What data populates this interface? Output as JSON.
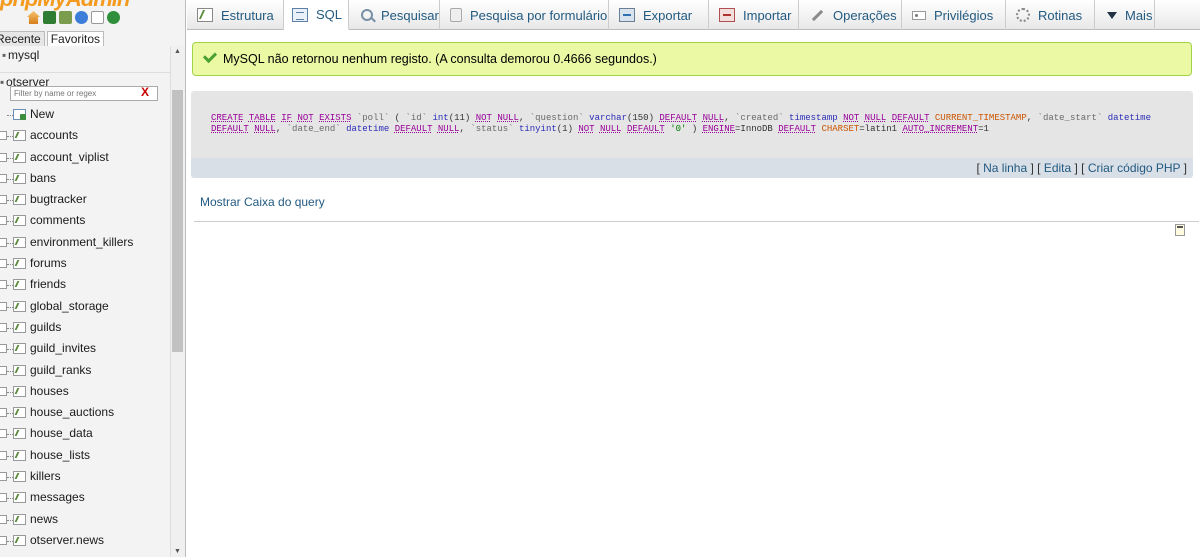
{
  "app": {
    "logo_text": "phpMyAdmin"
  },
  "nav": {
    "tabs": [
      "Recente",
      "Favoritos"
    ],
    "root_db": "mysql",
    "server": "otserver",
    "filter_placeholder": "Filter by name or regex",
    "filter_clear": "X",
    "new_label": "New",
    "tables": [
      "accounts",
      "account_viplist",
      "bans",
      "bugtracker",
      "comments",
      "environment_killers",
      "forums",
      "friends",
      "global_storage",
      "guilds",
      "guild_invites",
      "guild_ranks",
      "houses",
      "house_auctions",
      "house_data",
      "house_lists",
      "killers",
      "messages",
      "news",
      "otserver.news"
    ]
  },
  "topmenu": {
    "tabs": [
      {
        "label": "Estrutura",
        "icon": "structure-icon"
      },
      {
        "label": "SQL",
        "icon": "sql-icon",
        "active": true
      },
      {
        "label": "Pesquisar",
        "icon": "search-icon"
      },
      {
        "label": "Pesquisa por formulário",
        "icon": "form-icon"
      },
      {
        "label": "Exportar",
        "icon": "export-icon"
      },
      {
        "label": "Importar",
        "icon": "import-icon"
      },
      {
        "label": "Operações",
        "icon": "wrench-icon"
      },
      {
        "label": "Privilégios",
        "icon": "privileges-icon"
      },
      {
        "label": "Rotinas",
        "icon": "routines-icon"
      },
      {
        "label": "Mais",
        "icon": "dropdown-icon"
      }
    ]
  },
  "result": {
    "message": "MySQL não retornou nenhum registo. (A consulta demorou 0.4666 segundos.)",
    "query": "CREATE TABLE IF NOT EXISTS `poll` ( `id` int(11) NOT NULL, `question` varchar(150) DEFAULT NULL, `created` timestamp NOT NULL DEFAULT CURRENT_TIMESTAMP, `date_start` datetime DEFAULT NULL, `date_end` datetime DEFAULT NULL, `status` tinyint(1) NOT NULL DEFAULT '0' ) ENGINE=InnoDB DEFAULT CHARSET=latin1 AUTO_INCREMENT=1",
    "links": {
      "inline": "Na linha",
      "edit": "Edita",
      "php": "Criar código PHP"
    },
    "show_query_box": "Mostrar Caixa do query"
  },
  "colors": {
    "success_bg": "#ebf8a4",
    "success_border": "#a2d246",
    "link": "#235a81",
    "logo": "#f49a1f"
  }
}
